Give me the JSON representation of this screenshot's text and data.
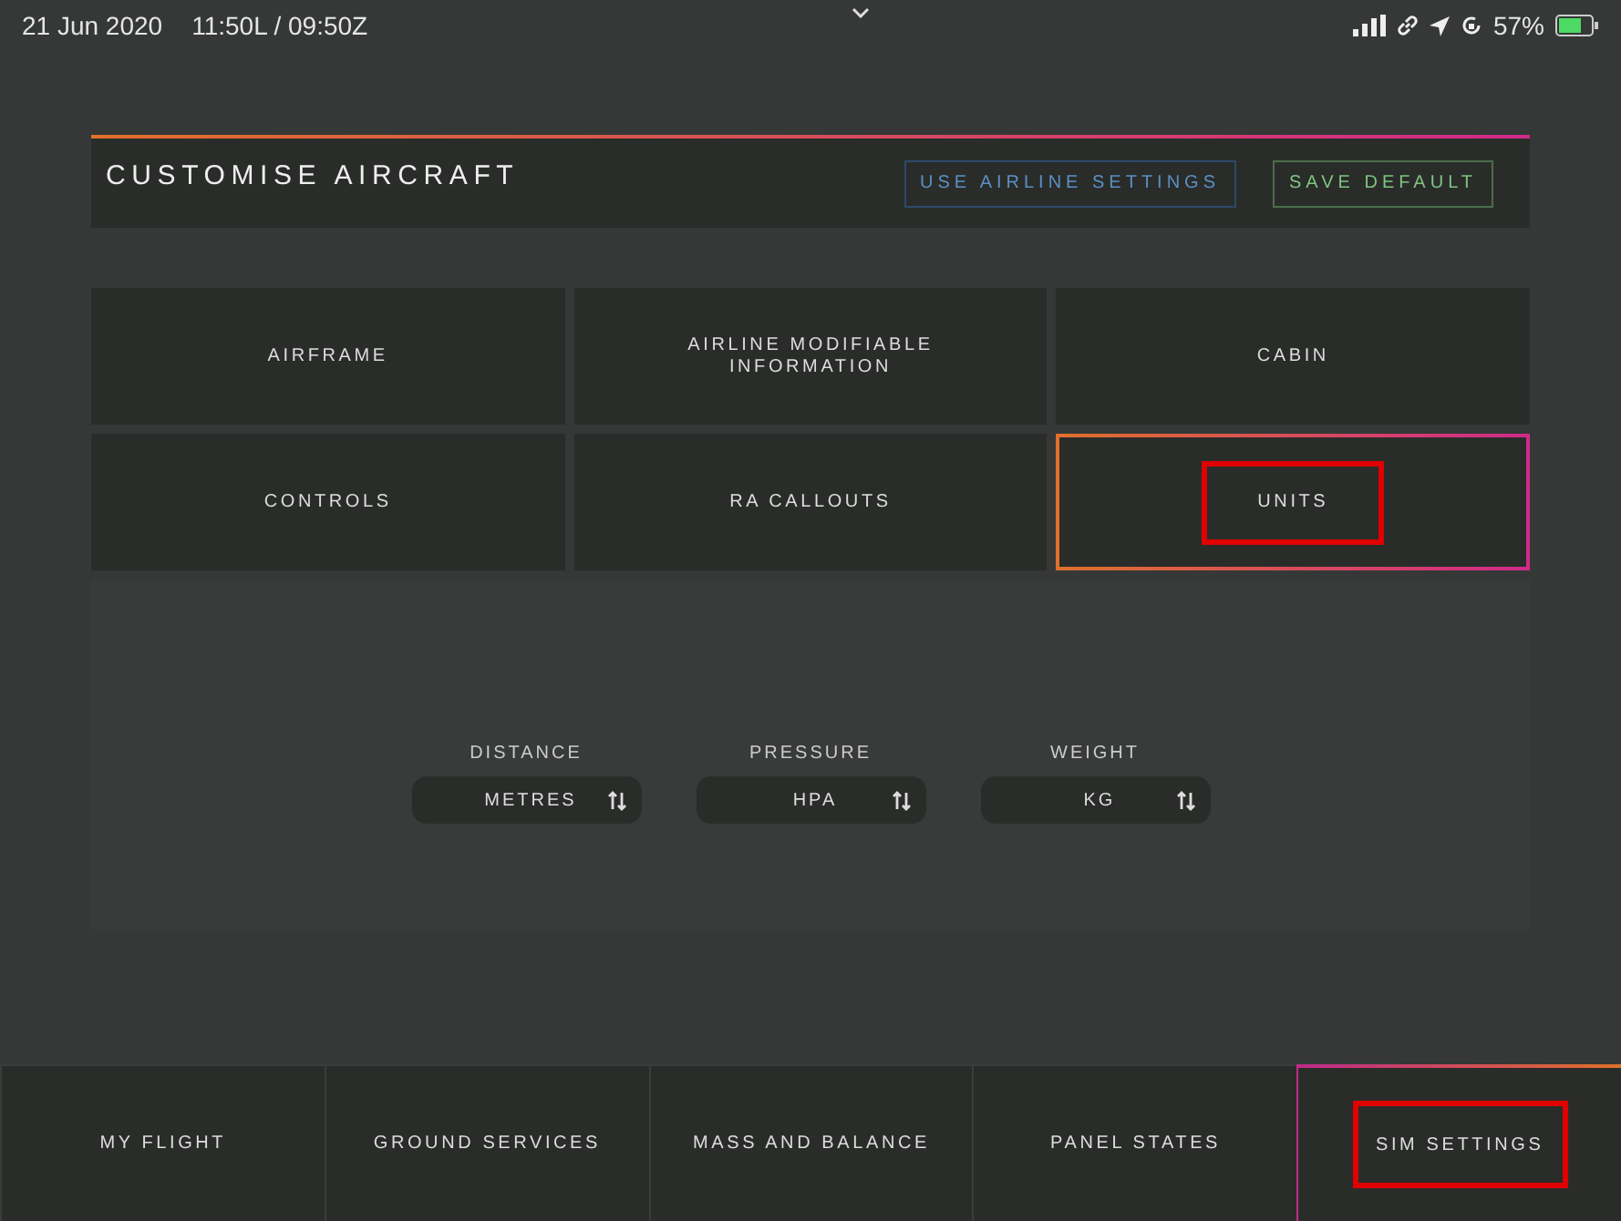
{
  "status_bar": {
    "date": "21 Jun 2020",
    "time": "11:50L / 09:50Z",
    "battery": "57%"
  },
  "header": {
    "title": "CUSTOMISE AIRCRAFT",
    "buttons": [
      {
        "label": "USE AIRLINE SETTINGS",
        "kind": "airline"
      },
      {
        "label": "SAVE DEFAULT",
        "kind": "save"
      }
    ]
  },
  "tiles": [
    {
      "label": "AIRFRAME",
      "selected": false,
      "highlighted": false
    },
    {
      "label": "AIRLINE MODIFIABLE INFORMATION",
      "selected": false,
      "highlighted": false
    },
    {
      "label": "CABIN",
      "selected": false,
      "highlighted": false
    },
    {
      "label": "CONTROLS",
      "selected": false,
      "highlighted": false
    },
    {
      "label": "RA CALLOUTS",
      "selected": false,
      "highlighted": false
    },
    {
      "label": "UNITS",
      "selected": true,
      "highlighted": true
    }
  ],
  "units": [
    {
      "label": "DISTANCE",
      "value": "METRES"
    },
    {
      "label": "PRESSURE",
      "value": "HPA"
    },
    {
      "label": "WEIGHT",
      "value": "KG"
    }
  ],
  "nav": [
    {
      "label": "MY FLIGHT",
      "selected": false,
      "highlighted": false
    },
    {
      "label": "GROUND SERVICES",
      "selected": false,
      "highlighted": false
    },
    {
      "label": "MASS AND BALANCE",
      "selected": false,
      "highlighted": false
    },
    {
      "label": "PANEL STATES",
      "selected": false,
      "highlighted": false
    },
    {
      "label": "SIM SETTINGS",
      "selected": true,
      "highlighted": true
    }
  ]
}
